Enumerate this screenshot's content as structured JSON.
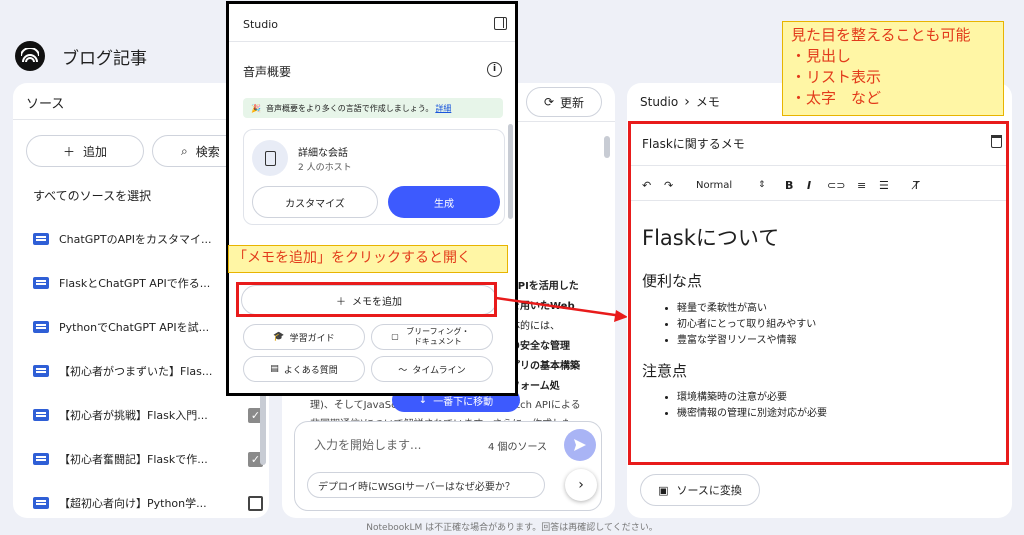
{
  "app": {
    "title": "ブログ記事"
  },
  "sources": {
    "title": "ソース",
    "add_label": "追加",
    "search_label": "検索",
    "select_all": "すべてのソースを選択",
    "items": [
      {
        "label": "ChatGPTのAPIをカスタマイ..."
      },
      {
        "label": "FlaskとChatGPT APIで作る..."
      },
      {
        "label": "PythonでChatGPT APIを試..."
      },
      {
        "label": "【初心者がつまずいた】Flas..."
      },
      {
        "label": "【初心者が挑戦】Flask入門..."
      },
      {
        "label": "【初心者奮闘記】Flaskで作..."
      },
      {
        "label": "【超初心者向け】Python学..."
      }
    ]
  },
  "chat": {
    "refresh_label": "更新",
    "text_lines": [
      "APIを活用した",
      "を用いたWeb",
      "体的には、",
      "の安全な管理",
      "プリの基本構築",
      "フォーム処",
      "理)、そしてJavaScr",
      "etch APIによる",
      "非同期通信)について解説されています。さらに、作成した"
    ],
    "scroll_label": "一番下に移動",
    "input_placeholder": "入力を開始します...",
    "source_count": "4 個のソース",
    "suggestion": "デプロイ時にWSGIサーバーはなぜ必要か？"
  },
  "studio": {
    "title": "Studio",
    "audio_title": "音声概要",
    "banner_text": "音声概要をより多くの言語で作成しましょう。",
    "banner_link": "詳細",
    "conversation_title": "詳細な会話",
    "conversation_sub": "2 人のホスト",
    "customize_label": "カスタマイズ",
    "generate_label": "生成",
    "add_note_label": "メモを追加",
    "tools": [
      "学習ガイド",
      "ブリーフィング・ドキュメント",
      "よくある質問",
      "タイムライン"
    ]
  },
  "note": {
    "breadcrumb_root": "Studio",
    "breadcrumb_current": "メモ",
    "title": "Flaskに関するメモ",
    "style_select": "Normal",
    "heading": "Flaskについて",
    "sections": [
      {
        "title": "便利な点",
        "items": [
          "軽量で柔軟性が高い",
          "初心者にとって取り組みやすい",
          "豊富な学習リソースや情報"
        ]
      },
      {
        "title": "注意点",
        "items": [
          "環境構築時の注意が必要",
          "機密情報の管理に別途対応が必要"
        ]
      }
    ],
    "convert_label": "ソースに変換"
  },
  "annotations": {
    "callout_top": [
      "見た目を整えることも可能",
      "・見出し",
      "・リスト表示",
      "・太字　など"
    ],
    "callout_left": "「メモを追加」をクリックすると開く"
  },
  "footer": {
    "disclaimer": "NotebookLM は不正確な場合があります。回答は再確認してください。"
  },
  "colors": {
    "accent": "#3d5afe",
    "highlight_red": "#e81b1b",
    "callout_bg": "#fff6a5",
    "callout_text": "#e23b1b"
  }
}
